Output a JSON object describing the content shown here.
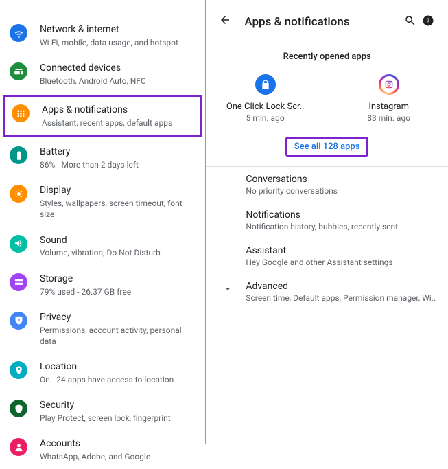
{
  "left": {
    "items": [
      {
        "title": "Network & internet",
        "sub": "Wi-Fi, mobile, data usage, and hotspot"
      },
      {
        "title": "Connected devices",
        "sub": "Bluetooth, Android Auto, NFC"
      },
      {
        "title": "Apps & notifications",
        "sub": "Assistant, recent apps, default apps"
      },
      {
        "title": "Battery",
        "sub": "86% - More than 2 days left"
      },
      {
        "title": "Display",
        "sub": "Styles, wallpapers, screen timeout, font size"
      },
      {
        "title": "Sound",
        "sub": "Volume, vibration, Do Not Disturb"
      },
      {
        "title": "Storage",
        "sub": "79% used - 26.37 GB free"
      },
      {
        "title": "Privacy",
        "sub": "Permissions, account activity, personal data"
      },
      {
        "title": "Location",
        "sub": "On - 24 apps have access to location"
      },
      {
        "title": "Security",
        "sub": "Play Protect, screen lock, fingerprint"
      },
      {
        "title": "Accounts",
        "sub": "WhatsApp, Adobe, and Google"
      }
    ]
  },
  "right": {
    "title": "Apps & notifications",
    "recent_header": "Recently opened apps",
    "recent_apps": [
      {
        "name": "One Click Lock Scr..",
        "time": "5 min. ago"
      },
      {
        "name": "Instagram",
        "time": "83 min. ago"
      }
    ],
    "see_all": "See all 128 apps",
    "sections": [
      {
        "title": "Conversations",
        "sub": "No priority conversations"
      },
      {
        "title": "Notifications",
        "sub": "Notification history, bubbles, recently sent"
      },
      {
        "title": "Assistant",
        "sub": "Hey Google and other Assistant settings"
      },
      {
        "title": "Advanced",
        "sub": "Screen time, Default apps, Permission manager, Wi.."
      }
    ]
  }
}
